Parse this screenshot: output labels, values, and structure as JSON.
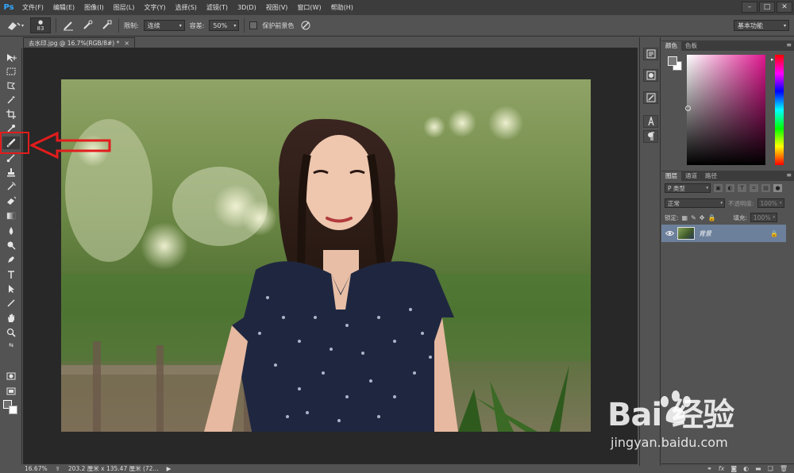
{
  "app": {
    "logo": "Ps"
  },
  "menu": [
    "文件(F)",
    "编辑(E)",
    "图像(I)",
    "图层(L)",
    "文字(Y)",
    "选择(S)",
    "滤镜(T)",
    "3D(D)",
    "视图(V)",
    "窗口(W)",
    "帮助(H)"
  ],
  "window_controls": [
    "–",
    "□",
    "✕"
  ],
  "options": {
    "brush_size": "83",
    "limit_label": "限制:",
    "limit_value": "连续",
    "tolerance_label": "容差:",
    "tolerance_value": "50%",
    "protect_fg_label": "保护前景色",
    "workspace": "基本功能"
  },
  "document": {
    "tab_title": "去水印.jpg @ 16.7%(RGB/8#) *",
    "close": "×"
  },
  "status": {
    "zoom": "16.67%",
    "doc_size": "203.2 厘米 x 135.47 厘米 (72...",
    "arrow": "▶"
  },
  "panels": {
    "color_tabs": [
      "颜色",
      "色板"
    ],
    "layers_tabs": [
      "图层",
      "通道",
      "路径"
    ],
    "filter_kind": "P 类型",
    "blend_mode": "正常",
    "opacity_label": "不透明度:",
    "opacity_value": "100%",
    "lock_label": "锁定:",
    "fill_label": "填充:",
    "fill_value": "100%",
    "layer_name": "背景",
    "menu_glyph": "≡"
  },
  "watermark": {
    "brand": "Bai 经验",
    "url": "jingyan.baidu.com"
  },
  "colors": {
    "highlight": "#e21c1c",
    "layer_selected": "#6c809b",
    "ps_blue": "#31a8ff"
  }
}
